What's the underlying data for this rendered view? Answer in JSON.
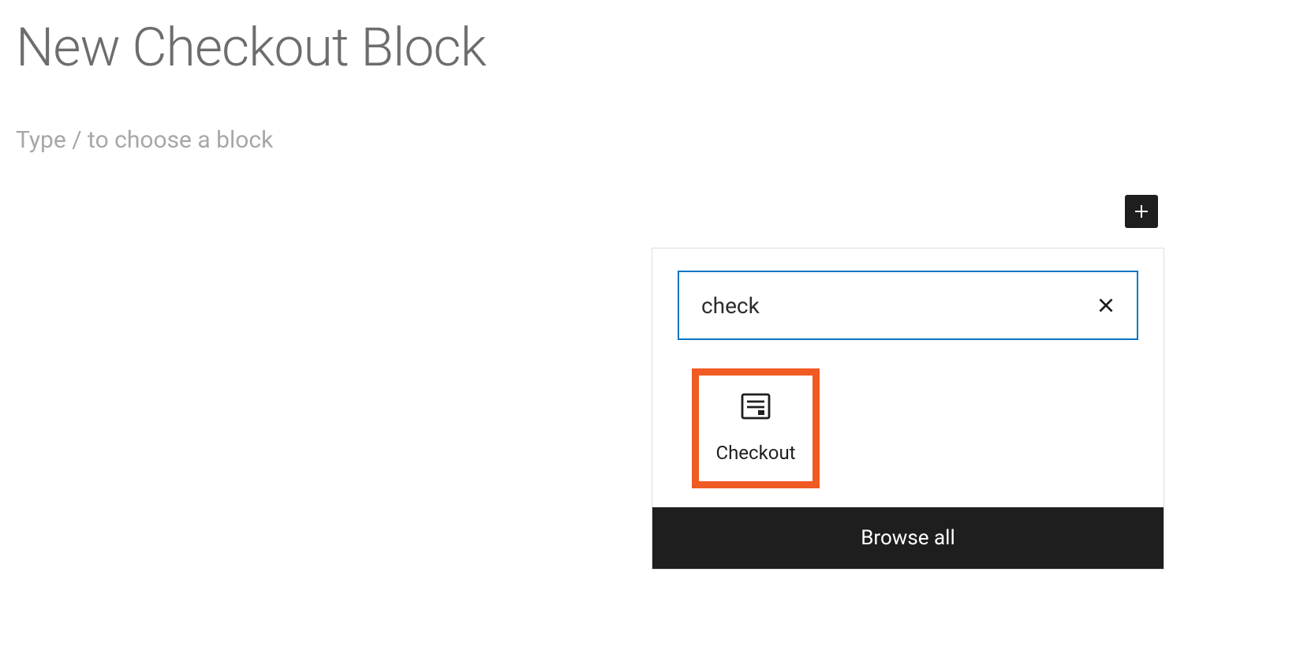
{
  "page": {
    "title": "New Checkout Block",
    "placeholder": "Type / to choose a block"
  },
  "inserter": {
    "search_value": "check",
    "results": [
      {
        "label": "Checkout",
        "icon": "checkout-icon"
      }
    ],
    "browse_all_label": "Browse all"
  }
}
